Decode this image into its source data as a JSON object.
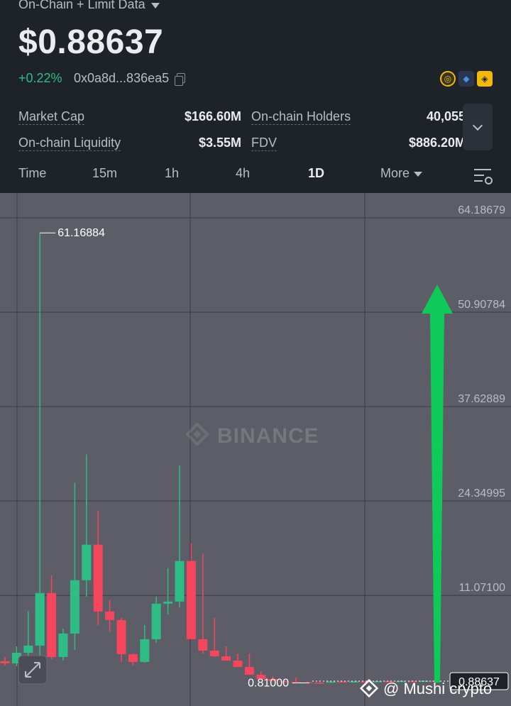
{
  "header": {
    "top_label": "On-Chain + Limit Data",
    "price": "$0.88637",
    "change": "+0.22%",
    "address": "0x0a8d...836ea5"
  },
  "stats": {
    "market_cap_label": "Market Cap",
    "market_cap_value": "$166.60M",
    "holders_label": "On-chain Holders",
    "holders_value": "40,055",
    "liquidity_label": "On-chain Liquidity",
    "liquidity_value": "$3.55M",
    "fdv_label": "FDV",
    "fdv_value": "$886.20M"
  },
  "tabs": [
    "Time",
    "15m",
    "1h",
    "4h",
    "1D",
    "More"
  ],
  "active_tab": "1D",
  "chart": {
    "y_axis_labels": [
      "64.18679",
      "50.90784",
      "37.62889",
      "24.34995",
      "11.07100"
    ],
    "max_label": "61.16884",
    "min_label": "0.81000",
    "last_price_label": "0.88637",
    "watermark": "BINANCE",
    "credit": "@ Mushi crypto",
    "colors": {
      "up": "#2ebd85",
      "down": "#f6465d",
      "arrow": "#0ecb59"
    }
  },
  "chart_data": {
    "type": "candlestick",
    "ylim": [
      -2.2,
      64.18679
    ],
    "candles": [
      {
        "o": 0.9,
        "h": 1.5,
        "l": 0.3,
        "c": 0.6
      },
      {
        "o": 0.6,
        "h": 3.0,
        "l": 0.2,
        "c": 2.1
      },
      {
        "o": 2.1,
        "h": 8.0,
        "l": 1.0,
        "c": 3.1
      },
      {
        "o": 3.1,
        "h": 61.16884,
        "l": 0.5,
        "c": 10.5
      },
      {
        "o": 10.5,
        "h": 13.0,
        "l": 1.2,
        "c": 1.5
      },
      {
        "o": 1.5,
        "h": 5.5,
        "l": 1.0,
        "c": 4.8
      },
      {
        "o": 4.8,
        "h": 26.0,
        "l": 2.5,
        "c": 12.3
      },
      {
        "o": 12.3,
        "h": 30.0,
        "l": 10.0,
        "c": 17.3
      },
      {
        "o": 17.3,
        "h": 22.0,
        "l": 6.0,
        "c": 7.9
      },
      {
        "o": 7.9,
        "h": 9.5,
        "l": 5.0,
        "c": 6.7
      },
      {
        "o": 6.7,
        "h": 7.0,
        "l": 0.8,
        "c": 1.9
      },
      {
        "o": 1.9,
        "h": 2.0,
        "l": 0.3,
        "c": 0.8
      },
      {
        "o": 0.8,
        "h": 6.0,
        "l": 0.7,
        "c": 4.0
      },
      {
        "o": 4.0,
        "h": 10.0,
        "l": 3.5,
        "c": 9.0
      },
      {
        "o": 9.0,
        "h": 14.0,
        "l": 7.5,
        "c": 9.3
      },
      {
        "o": 9.3,
        "h": 28.5,
        "l": 8.5,
        "c": 15.0
      },
      {
        "o": 15.0,
        "h": 17.5,
        "l": 4.5,
        "c": 4.0
      },
      {
        "o": 4.0,
        "h": 16.0,
        "l": 2.0,
        "c": 2.4
      },
      {
        "o": 2.4,
        "h": 7.0,
        "l": 1.5,
        "c": 1.6
      },
      {
        "o": 1.6,
        "h": 3.0,
        "l": 1.0,
        "c": 1.0
      },
      {
        "o": 1.0,
        "h": 2.0,
        "l": 0.3,
        "c": 0.1
      },
      {
        "o": 0.1,
        "h": 2.0,
        "l": -0.5,
        "c": -1.0
      },
      {
        "o": -1.0,
        "h": -0.5,
        "l": -1.7,
        "c": -1.6
      },
      {
        "o": -1.6,
        "h": -1.2,
        "l": -1.9,
        "c": -1.9
      },
      {
        "o": -1.9,
        "h": -1.8,
        "l": -2.0,
        "c": -2.0
      },
      {
        "o": -2.0,
        "h": -1.4,
        "l": -2.1,
        "c": -2.05
      },
      {
        "o": -2.05,
        "h": -1.9,
        "l": -2.1,
        "c": -2.1
      },
      {
        "o": -2.1,
        "h": -2.0,
        "l": -2.15,
        "c": -2.12
      },
      {
        "o": -2.12,
        "h": -1.9,
        "l": -2.15,
        "c": -1.95
      },
      {
        "o": -1.95,
        "h": -1.9,
        "l": -2.1,
        "c": -2.05
      },
      {
        "o": -2.05,
        "h": -1.9,
        "l": -2.1,
        "c": -1.95
      },
      {
        "o": -1.95,
        "h": -1.9,
        "l": -2.05,
        "c": -2.0
      },
      {
        "o": -2.0,
        "h": -1.85,
        "l": -2.05,
        "c": -1.9
      },
      {
        "o": -1.9,
        "h": -1.85,
        "l": -2.0,
        "c": -1.95
      },
      {
        "o": -1.95,
        "h": -1.8,
        "l": -2.0,
        "c": -1.88
      },
      {
        "o": -1.88,
        "h": -1.8,
        "l": -1.95,
        "c": -1.92
      },
      {
        "o": -1.92,
        "h": -1.8,
        "l": -1.95,
        "c": -1.85
      },
      {
        "o": -1.85,
        "h": -1.8,
        "l": -1.95,
        "c": -1.9
      }
    ]
  }
}
